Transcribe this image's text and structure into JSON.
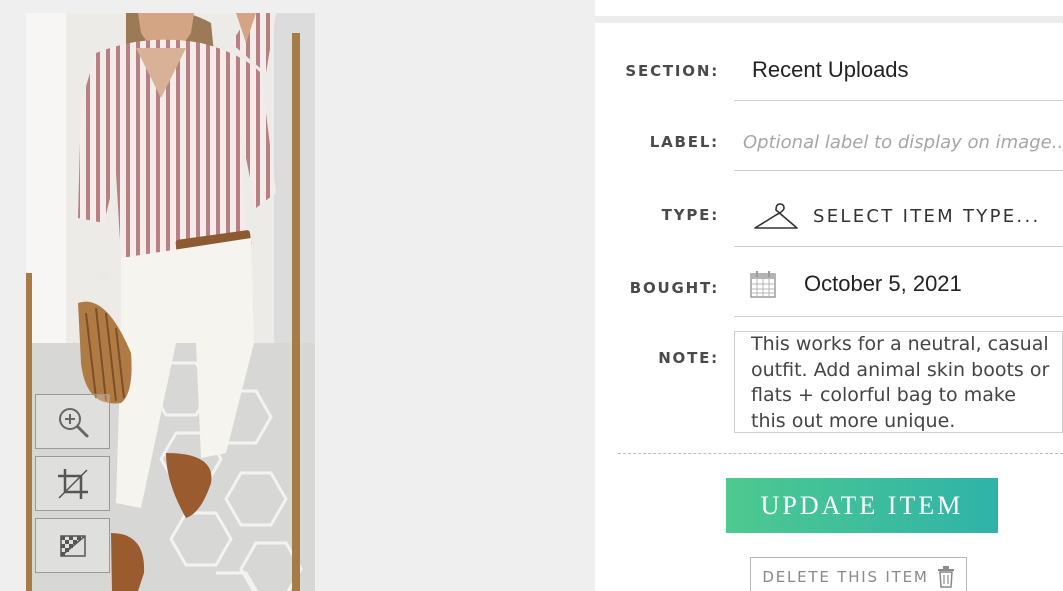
{
  "form": {
    "section_label": "SECTION:",
    "section_value": "Recent Uploads",
    "label_label": "LABEL:",
    "label_placeholder": "Optional label to display on image...",
    "type_label": "TYPE:",
    "type_value": "SELECT ITEM TYPE...",
    "bought_label": "BOUGHT:",
    "bought_value": "October 5, 2021",
    "note_label": "NOTE:",
    "note_value": "This works for a neutral, casual outfit. Add animal skin boots or flats + colorful bag to make this out more unique."
  },
  "actions": {
    "update_label": "UPDATE ITEM",
    "delete_label": "DELETE THIS ITEM"
  },
  "tools": [
    "zoom-in-icon",
    "crop-icon",
    "background-remove-icon"
  ],
  "icons": {
    "type": "hanger-icon",
    "bought": "calendar-icon",
    "delete": "trash-icon"
  },
  "colors": {
    "update_button_start": "#4ec98f",
    "update_button_end": "#2fb3a9",
    "label_text": "#4a4a4a",
    "placeholder": "#a6a6a6"
  }
}
